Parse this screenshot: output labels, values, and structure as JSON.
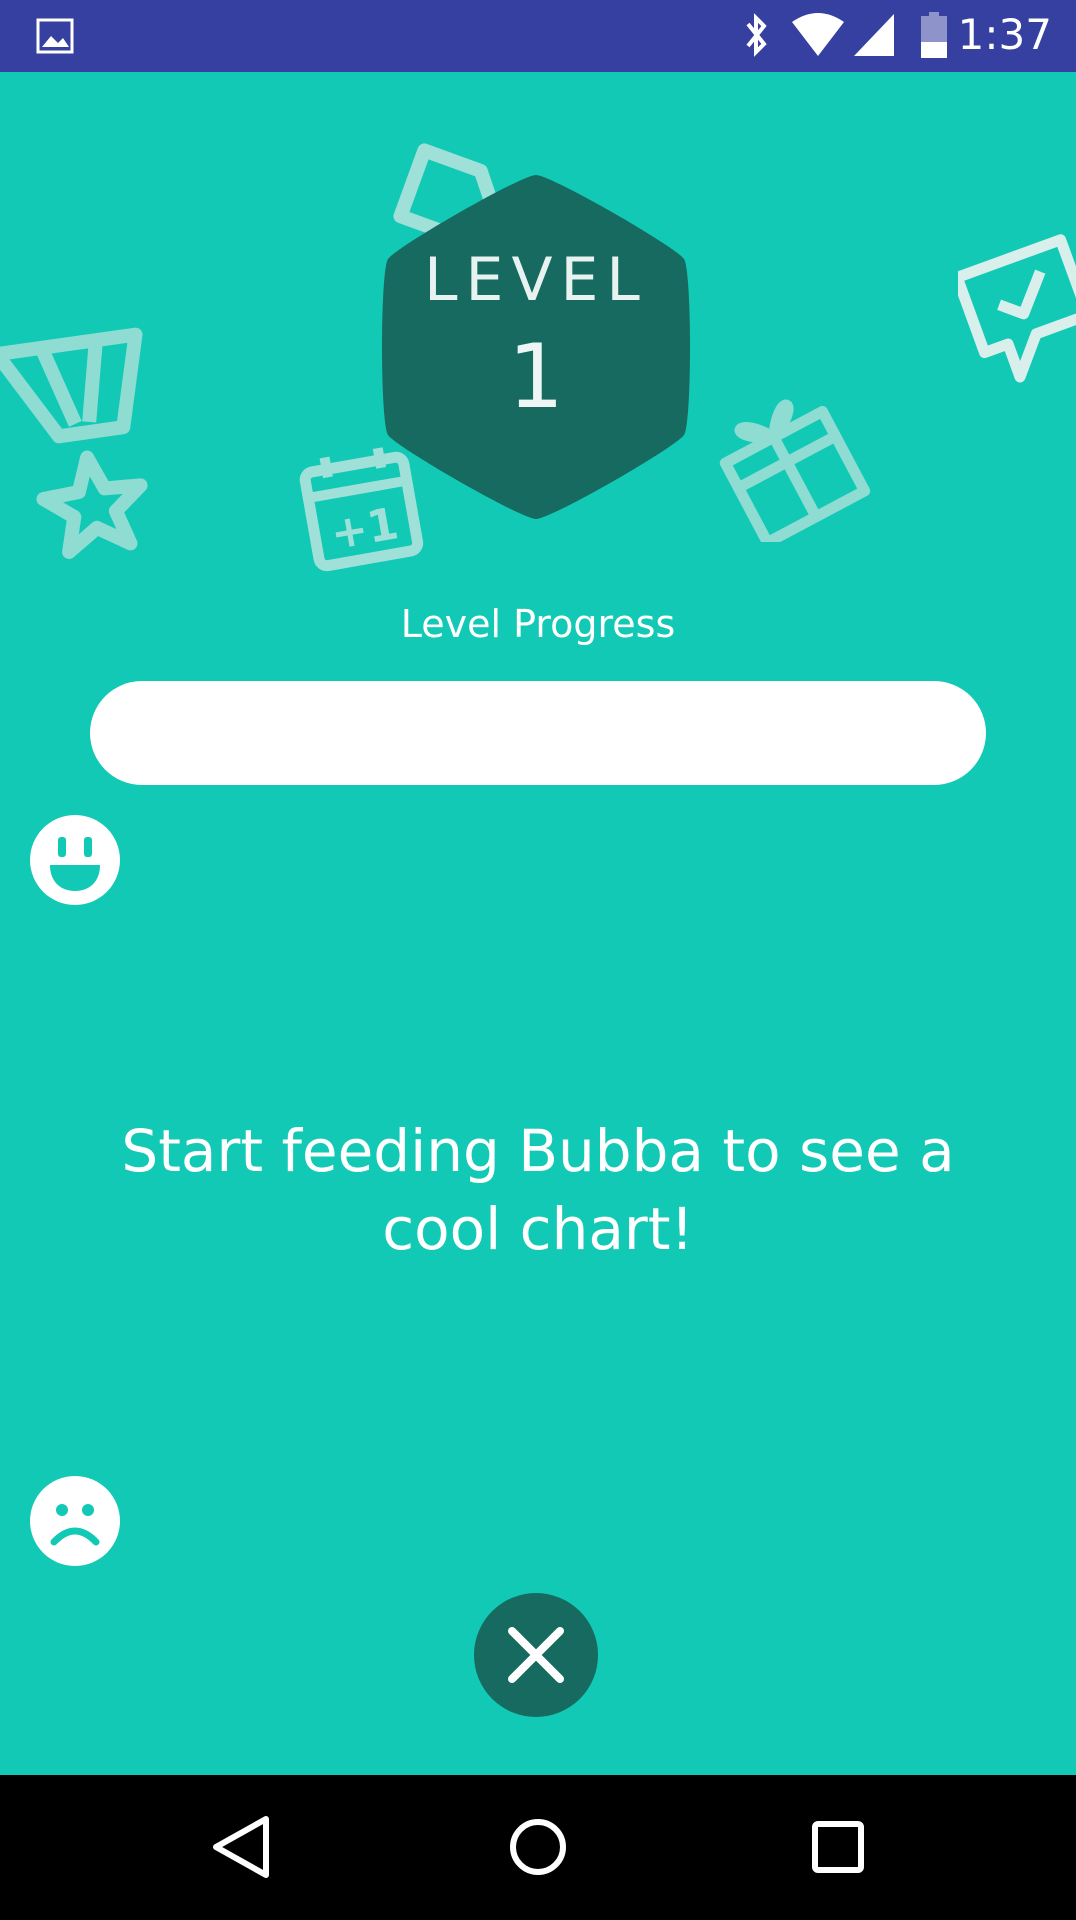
{
  "status_bar": {
    "time": "1:37",
    "icons": [
      "image-notification-icon",
      "bluetooth-icon",
      "wifi-icon",
      "cellular-signal-icon",
      "battery-icon"
    ]
  },
  "badge": {
    "level_label": "LEVEL",
    "level_number": "1"
  },
  "progress": {
    "label": "Level Progress",
    "value_fraction": 0
  },
  "chart_area": {
    "empty_message": "Start feeding Bubba to see a cool chart!",
    "top_face_icon": "happy-face-icon",
    "bottom_face_icon": "sad-face-icon"
  },
  "actions": {
    "close_icon": "close-icon"
  },
  "nav_bar": {
    "icons": [
      "back-icon",
      "home-icon",
      "recents-icon"
    ]
  },
  "colors": {
    "background": "#12c9b5",
    "status_bar": "#3540a1",
    "badge": "#166a5f",
    "progress_track": "#ffffff"
  }
}
